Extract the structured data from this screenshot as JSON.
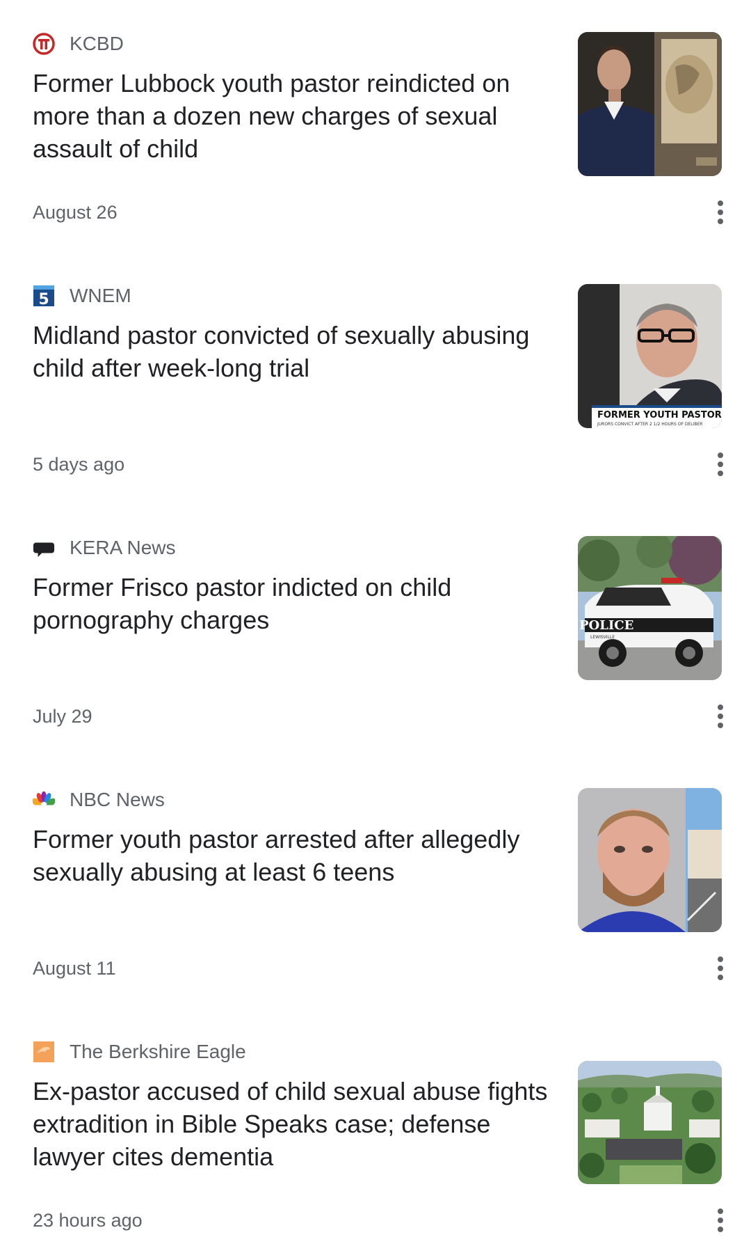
{
  "articles": [
    {
      "source": "KCBD",
      "source_icon": "kcbd-logo-icon",
      "headline": "Former Lubbock youth pastor reindicted on more than a dozen new charges of sexual assault of child",
      "timestamp": "August 26"
    },
    {
      "source": "WNEM",
      "source_icon": "wnem-logo-icon",
      "headline": "Midland pastor convicted of sexually abusing child after week-long trial",
      "timestamp": "5 days ago",
      "thumb_caption": "FORMER YOUTH PASTOR C",
      "thumb_subcaption": "JURORS CONVICT AFTER 2 1/2 HOURS OF DELIBER"
    },
    {
      "source": "KERA News",
      "source_icon": "kera-logo-icon",
      "headline": "Former Frisco pastor indicted on child pornography charges",
      "timestamp": "July 29",
      "thumb_caption": "POLICE",
      "thumb_subcaption": "LEWISVILLE"
    },
    {
      "source": "NBC News",
      "source_icon": "nbc-peacock-icon",
      "headline": "Former youth pastor arrested after allegedly sexually abusing at least 6 teens",
      "timestamp": "August 11"
    },
    {
      "source": "The Berkshire Eagle",
      "source_icon": "berkshire-eagle-logo-icon",
      "headline": "Ex-pastor accused of child sexual abuse fights extradition in Bible Speaks case; defense lawyer cites dementia",
      "timestamp": "23 hours ago"
    }
  ],
  "colors": {
    "headline": "#202124",
    "meta": "#5f6368",
    "kcbd_red": "#c62828",
    "wnem_blue": "#1a4c8b",
    "berkshire_orange": "#f4a259"
  }
}
